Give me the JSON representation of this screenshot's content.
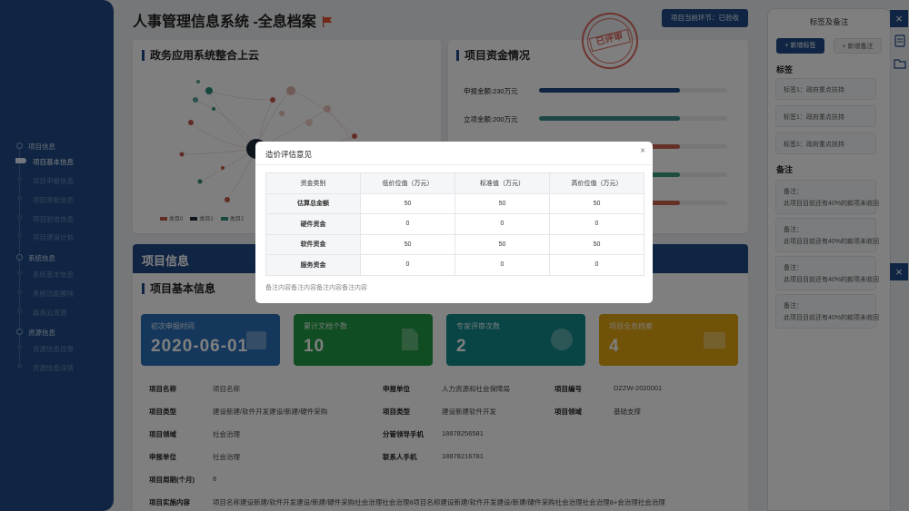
{
  "page_title": "人事管理信息系统 -全息档案",
  "header": {
    "phase_button": "项目当前环节：已验收",
    "stamp": "已评审"
  },
  "sidebar": {
    "groups": [
      {
        "label": "项目信息",
        "items": [
          "项目基本信息",
          "项目申报信息",
          "项目审批信息",
          "项目验收信息",
          "项目建设计划"
        ]
      },
      {
        "label": "系统信息",
        "items": [
          "系统基本信息",
          "系统功能模块",
          "政务云资源"
        ]
      },
      {
        "label": "资源信息",
        "items": [
          "资源信息目录",
          "资源信息详情"
        ]
      }
    ]
  },
  "graph_panel": {
    "title": "政务应用系统整合上云",
    "legend": [
      "类目0",
      "类目1",
      "类目2"
    ]
  },
  "funds_panel": {
    "title": "项目资金情况",
    "rows": [
      {
        "label": "申报金额:230万元",
        "fraction": 0.75,
        "color": "#1e4a86"
      },
      {
        "label": "立项金额:200万元",
        "fraction": 0.75,
        "color": "#3a8c8f"
      }
    ],
    "hidden_bars": [
      {
        "fraction": 0.75,
        "color": "#c9634e"
      },
      {
        "fraction": 0.75,
        "color": "#3a9a78"
      },
      {
        "fraction": 0.75,
        "color": "#c9634e"
      }
    ]
  },
  "project_band": "项目信息",
  "basic_title": "项目基本信息",
  "stats": [
    {
      "label": "初次申报时间",
      "value": "2020-06-01",
      "color": "#2a6fb6",
      "icon": "calendar-icon"
    },
    {
      "label": "累计文档个数",
      "value": "10",
      "color": "#239b46",
      "icon": "document-icon"
    },
    {
      "label": "专家评审次数",
      "value": "2",
      "color": "#138a8a",
      "icon": "check-icon"
    },
    {
      "label": "项目全息档案",
      "value": "4",
      "color": "#e0a512",
      "icon": "archive-icon"
    }
  ],
  "info": {
    "col1": [
      {
        "label": "项目名称",
        "value": "项目名称"
      },
      {
        "label": "项目类型",
        "value": "建设新建/软件开发建设/新建/硬件采购"
      },
      {
        "label": "项目领域",
        "value": "社会治理"
      },
      {
        "label": "申报单位",
        "value": "社会治理"
      },
      {
        "label": "项目周期(个月)",
        "value": "8"
      }
    ],
    "col2": [
      {
        "label": "申报单位",
        "value": "人力资源和社会保障局"
      },
      {
        "label": "项目类型",
        "value": "建设新建软件开发"
      },
      {
        "label": "分管领导手机",
        "value": "18878256581"
      },
      {
        "label": "联系人手机",
        "value": "18878216781"
      }
    ],
    "col3": [
      {
        "label": "项目编号",
        "value": "DZZW-2020001"
      },
      {
        "label": "项目领域",
        "value": "基础支撑"
      }
    ],
    "content_label": "项目实施内容",
    "content_value": "项目名称建设新建/软件开发建设/新建/硬件采购社会治理社会治理8项目名称建设新建/软件开发建设/新建/硬件采购社会治理社会治理8+会治理社会治理"
  },
  "right_panel": {
    "title": "标签及备注",
    "add_tag": "+ 新增标签",
    "add_note": "+ 新增备注",
    "tags_title": "标签",
    "tags": [
      "标签1：政府重点扶持",
      "标签1：政府重点扶持",
      "标签1：政府重点扶持"
    ],
    "notes_title": "备注",
    "notes": [
      {
        "head": "备注：",
        "text": "此项目目前还有40%的款项未收回"
      },
      {
        "head": "备注：",
        "text": "此项目目前还有40%的款项未收回"
      },
      {
        "head": "备注：",
        "text": "此项目目前还有40%的款项未收回"
      },
      {
        "head": "备注：",
        "text": "此项目目前还有40%的款项未收回"
      }
    ]
  },
  "modal": {
    "title": "造价评估意见",
    "columns": [
      "资金类别",
      "低价位值（万元）",
      "标准值（万元）",
      "高价位值（万元）"
    ],
    "rows": [
      [
        "估算总金额",
        "50",
        "50",
        "50"
      ],
      [
        "硬件资金",
        "0",
        "0",
        "0"
      ],
      [
        "软件资金",
        "50",
        "50",
        "50"
      ],
      [
        "服务资金",
        "0",
        "0",
        "0"
      ]
    ],
    "note": "备注内容备注内容备注内容备注内容"
  }
}
